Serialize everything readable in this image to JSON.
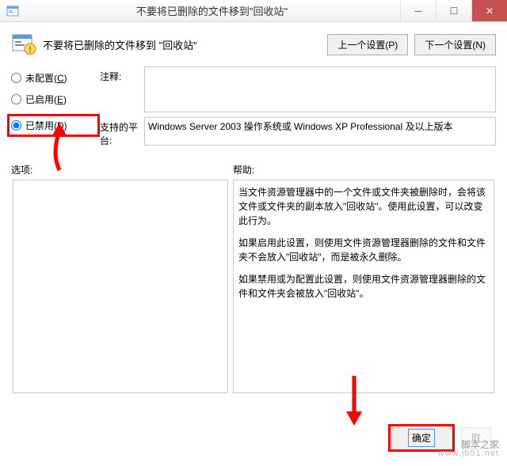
{
  "window": {
    "title": "不要将已删除的文件移到\"回收站\""
  },
  "header": {
    "title": "不要将已删除的文件移到 \"回收站\"",
    "prev_btn": "上一个设置(P)",
    "next_btn": "下一个设置(N)"
  },
  "radios": {
    "not_configured": "未配置(C)",
    "enabled": "已启用(E)",
    "disabled": "已禁用(D)"
  },
  "fields": {
    "comment_label": "注释:",
    "comment_value": "",
    "platform_label": "支持的平台:",
    "platform_value": "Windows Server 2003 操作系统或 Windows XP Professional 及以上版本"
  },
  "lower": {
    "options_label": "选项:",
    "help_label": "帮助:",
    "options_content": "",
    "help_p1": "当文件资源管理器中的一个文件或文件夹被删除时，会将该文件或文件夹的副本放入\"回收站\"。使用此设置，可以改变此行为。",
    "help_p2": "如果启用此设置，则使用文件资源管理器删除的文件和文件夹不会放入\"回收站\"，而是被永久删除。",
    "help_p3": "如果禁用或为配置此设置，则使用文件资源管理器删除的文件和文件夹会被放入\"回收站\"。"
  },
  "footer": {
    "ok": "确定",
    "cancel": "取"
  },
  "watermark": {
    "text": "脚本之家",
    "url": "www.jb51.net"
  }
}
